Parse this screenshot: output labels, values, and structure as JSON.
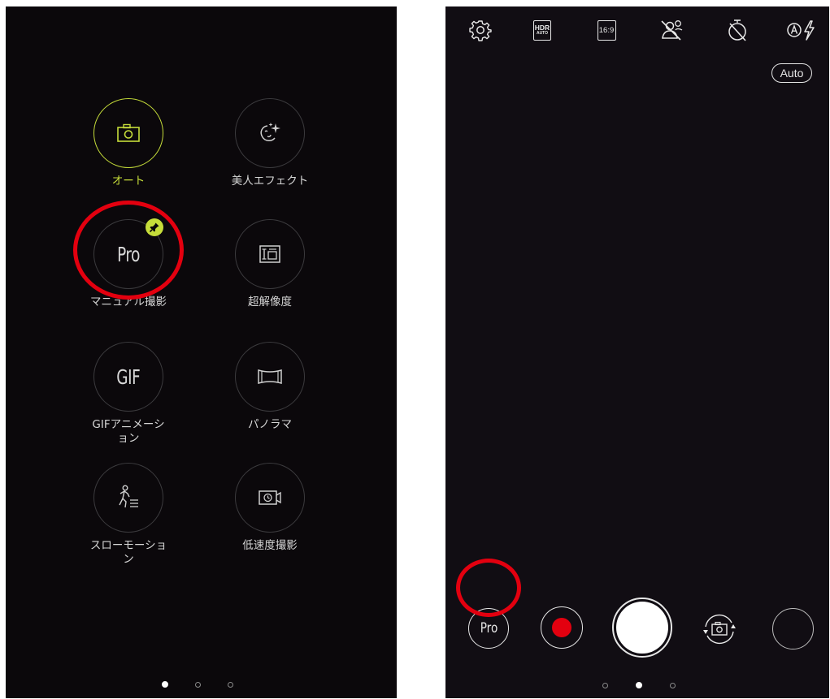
{
  "mode_menu": {
    "modes": [
      {
        "label": "オート",
        "icon": "camera-icon",
        "active": true
      },
      {
        "label": "美人エフェクト",
        "icon": "beauty-sparkle-icon"
      },
      {
        "label": "マニュアル撮影",
        "glyph": "Pro",
        "pinned": true
      },
      {
        "label": "超解像度",
        "icon": "super-resolution-icon"
      },
      {
        "label": "GIFアニメーション",
        "glyph": "GIF"
      },
      {
        "label": "パノラマ",
        "icon": "panorama-icon"
      },
      {
        "label": "スローモーション",
        "icon": "slow-motion-icon"
      },
      {
        "label": "低速度撮影",
        "icon": "time-lapse-icon"
      }
    ],
    "page_indicator": {
      "count": 3,
      "active": 0
    }
  },
  "camera": {
    "toolbar": {
      "hdr_label_top": "HDR",
      "hdr_label_bottom": "AUTO",
      "aspect_ratio": "16:9",
      "flash_mode": "auto"
    },
    "scene_mode": "Auto",
    "bottom": {
      "mode_button": "Pro"
    },
    "page_indicator": {
      "count": 3,
      "active": 1
    }
  },
  "colors": {
    "accent": "#c6dd3a",
    "highlight_ring": "#e3000f",
    "record": "#e3000f"
  }
}
